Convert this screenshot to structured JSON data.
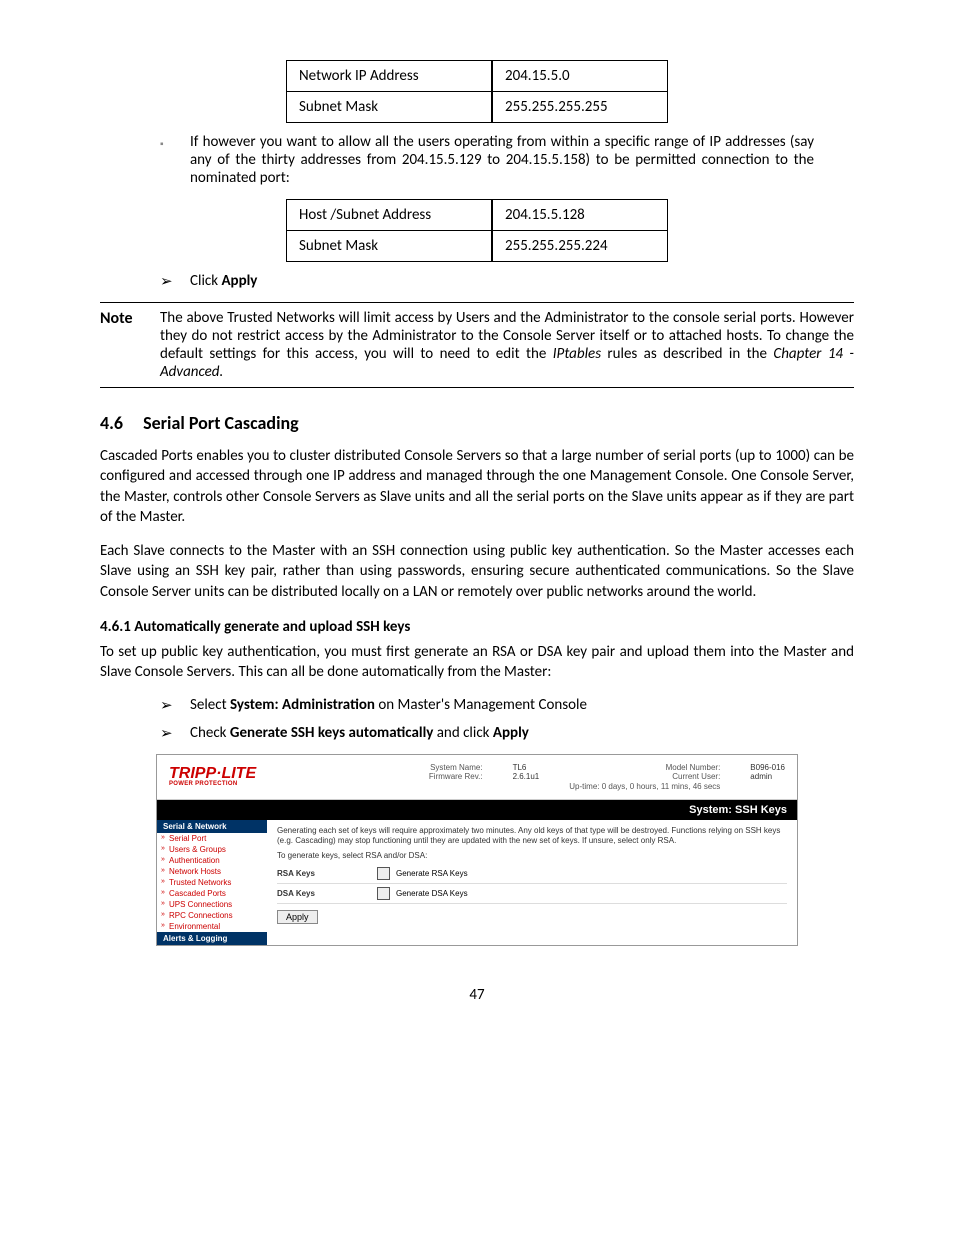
{
  "table1": {
    "r1c1": "Network IP Address",
    "r1c2": "204.15.5.0",
    "r2c1": "Subnet Mask",
    "r2c2": "255.255.255.255"
  },
  "para1": "If however you want to allow all the users operating from within a specific range of IP addresses (say any of the thirty addresses from 204.15.5.129 to 204.15.5.158) to be permitted connection to the nominated port:",
  "table2": {
    "r1c1": "Host /Subnet Address",
    "r1c2": "204.15.5.128",
    "r2c1": "Subnet Mask",
    "r2c2": "255.255.255.224"
  },
  "click_prefix": "Click ",
  "apply": "Apply",
  "note_label": "Note",
  "note_text_1": "The above Trusted Networks will limit access by Users and the Administrator to the console serial ports. However they do not restrict access by the Administrator to the Console Server itself or to attached hosts. To change the default settings for this access, you will to need to edit the ",
  "note_italic_1": "IPtables",
  "note_text_2": " rules as described in the ",
  "note_italic_2": "Chapter 14 - Advanced.",
  "section_no": "4.6",
  "section_title": "Serial Port Cascading",
  "para2": "Cascaded Ports enables you to cluster distributed Console Servers so that a large number of serial ports (up to 1000) can be configured and accessed through one IP address and managed through the one Management Console. One Console Server, the Master, controls other Console Servers as Slave units and all the serial ports on the Slave units appear as if they are part of the Master.",
  "para3": "Each Slave connects to the Master with an SSH connection using public key authentication. So the Master accesses each Slave using an SSH key pair, rather than using passwords, ensuring secure authenticated communications. So the Slave Console Server units can be distributed locally on a LAN or remotely over public networks around the world.",
  "subsection": "4.6.1 Automatically generate and upload SSH keys",
  "para4": "To set up public key authentication, you must first generate an RSA or DSA key pair and upload them into the Master and Slave Console Servers. This can all be done automatically from the Master:",
  "step1_pre": "Select ",
  "step1_bold": "System: Administration",
  "step1_post": " on Master's Management Console",
  "step2_pre": "Check ",
  "step2_bold": "Generate SSH keys automatically",
  "step2_mid": " and click ",
  "step2_bold2": "Apply",
  "ui": {
    "logo": "TRIPP·LITE",
    "logo_sub": "POWER PROTECTION",
    "sys_name_lbl": "System Name:",
    "sys_name_val": "TL6",
    "fw_lbl": "Firmware Rev.:",
    "fw_val": "2.6.1u1",
    "model_lbl": "Model Number:",
    "model_val": "B096-016",
    "user_lbl": "Current User:",
    "user_val": "admin",
    "uptime": "Up-time: 0 days, 0 hours, 11 mins, 46 secs",
    "blackbar": "System: SSH Keys",
    "sidehead1": "Serial & Network",
    "side_items": [
      "Serial Port",
      "Users & Groups",
      "Authentication",
      "Network Hosts",
      "Trusted Networks",
      "Cascaded Ports",
      "UPS Connections",
      "RPC Connections",
      "Environmental"
    ],
    "sidehead2": "Alerts & Logging",
    "instruct": "Generating each set of keys will require approximately two minutes. Any old keys of that type will be destroyed. Functions relying on SSH keys (e.g. Cascading) may stop functioning until they are updated with the new set of keys. If unsure, select only RSA.",
    "sub": "To generate keys, select RSA and/or DSA:",
    "rsa_label": "RSA Keys",
    "rsa_hint": "Generate RSA Keys",
    "dsa_label": "DSA Keys",
    "dsa_hint": "Generate DSA Keys",
    "apply_btn": "Apply"
  },
  "page_no": "47"
}
